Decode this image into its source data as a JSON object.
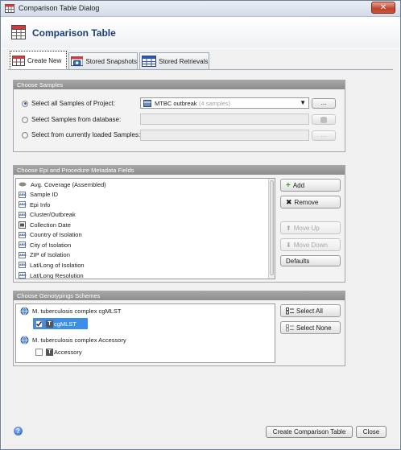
{
  "window": {
    "title": "Comparison Table Dialog",
    "close_glyph": "✕"
  },
  "header": {
    "title": "Comparison Table",
    "icon": "table-icon"
  },
  "tabs": [
    {
      "label": "Create New",
      "icon": "table-new-icon",
      "active": true
    },
    {
      "label": "Stored Snapshots",
      "icon": "camera-table-icon",
      "active": false
    },
    {
      "label": "Stored Retrievals",
      "icon": "table-blue-icon",
      "active": false
    }
  ],
  "samples_panel": {
    "heading": "Choose Samples",
    "options": [
      {
        "label": "Select all Samples of Project:",
        "selected": true
      },
      {
        "label": "Select Samples from database:",
        "selected": false
      },
      {
        "label": "Select from currently loaded Samples:",
        "selected": false
      }
    ],
    "project_combo": {
      "value": "MTBC outbreak",
      "hint": "(4 samples)"
    },
    "dots_label": "..."
  },
  "fields_panel": {
    "heading": "Choose Epi and Procedure Metadata Fields",
    "items": [
      {
        "label": "Avg. Coverage (Assembled)",
        "icon": "oval-icon"
      },
      {
        "label": "Sample ID",
        "icon": "abc-icon"
      },
      {
        "label": "Epi Info",
        "icon": "abc-icon"
      },
      {
        "label": "Cluster/Outbreak",
        "icon": "abc-icon"
      },
      {
        "label": "Collection Date",
        "icon": "date-icon"
      },
      {
        "label": "Country of Isolation",
        "icon": "abc-icon"
      },
      {
        "label": "City of Isolation",
        "icon": "abc-icon"
      },
      {
        "label": "ZIP of Isolation",
        "icon": "abc-icon"
      },
      {
        "label": "Lat/Long of Isolation",
        "icon": "abc-icon"
      },
      {
        "label": "Lat/Long Resolution",
        "icon": "abc-icon"
      }
    ],
    "icon_text_abc": "ABC",
    "buttons": {
      "add": "Add",
      "remove": "Remove",
      "move_up": "Move Up",
      "move_down": "Move Down",
      "defaults": "Defaults"
    }
  },
  "schemes_panel": {
    "heading": "Choose Genotypings Schemes",
    "tree": [
      {
        "label": "M. tuberculosis complex cgMLST",
        "icon": "globe-icon",
        "level": 0
      },
      {
        "label": "cgMLST",
        "icon": "t-icon",
        "level": 1,
        "checked": true,
        "selected": true
      },
      {
        "label": "M. tuberculosis complex Accessory",
        "icon": "globe-icon",
        "level": 0
      },
      {
        "label": "Accessory",
        "icon": "t-icon",
        "level": 1,
        "checked": false,
        "selected": false
      }
    ],
    "t_glyph": "T",
    "buttons": {
      "select_all": "Select All",
      "select_none": "Select None"
    }
  },
  "footer": {
    "help_glyph": "?",
    "create_button": "Create Comparison Table",
    "close_button": "Close"
  },
  "colors": {
    "header_title": "#1e3d78",
    "panel_head": "#8c8c8c",
    "selection": "#3d8ee8",
    "close_button": "#c0432a"
  }
}
